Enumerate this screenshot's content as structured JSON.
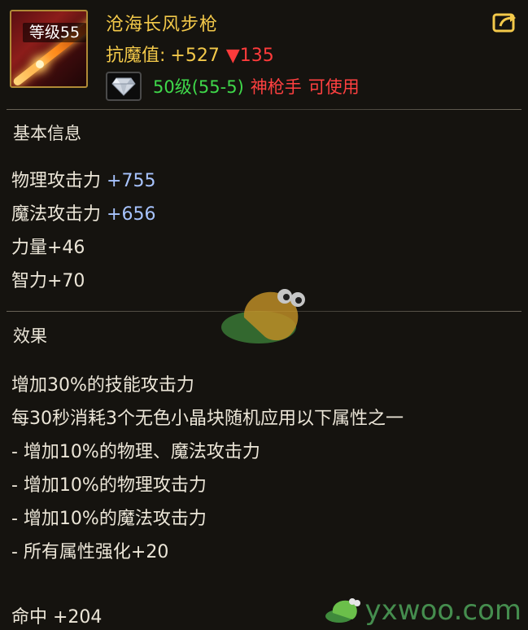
{
  "item": {
    "level_badge": "等级55",
    "name": "沧海长风步枪",
    "stat_label": "抗魔值:",
    "stat_value": "+527",
    "stat_diff": "▼135",
    "req_level": "50级(55-5)",
    "req_class": "神枪手",
    "req_usable": "可使用"
  },
  "sections": {
    "basic": {
      "title": "基本信息",
      "lines": [
        {
          "label": "物理攻击力",
          "value": "+755"
        },
        {
          "label": "魔法攻击力",
          "value": "+656"
        },
        {
          "label": "力量+46",
          "value": ""
        },
        {
          "label": "智力+70",
          "value": ""
        }
      ]
    },
    "effect": {
      "title": "效果",
      "lines": [
        "增加30%的技能攻击力",
        "每30秒消耗3个无色小晶块随机应用以下属性之一",
        "- 增加10%的物理、魔法攻击力",
        "- 增加10%的物理攻击力",
        "- 增加10%的魔法攻击力",
        "- 所有属性强化+20"
      ]
    },
    "extra": {
      "hit": "命中 +204"
    }
  },
  "watermark": {
    "text": "yxwoo.com"
  },
  "colors": {
    "gold": "#f3c94a",
    "red": "#ff3b3b",
    "green": "#3fd84a",
    "blue": "#a8c4ff"
  },
  "icons": {
    "share": "share-arrow-icon",
    "gem": "diamond-gem-icon"
  }
}
